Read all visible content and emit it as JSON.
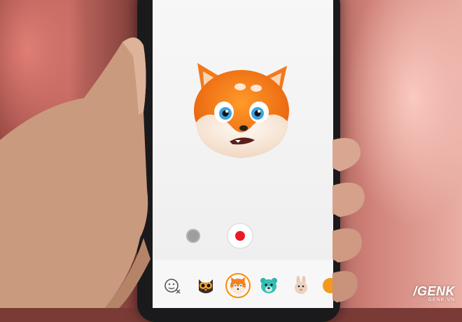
{
  "scene": {
    "description_tags": [
      "hand",
      "phone",
      "animated-emoji-camera"
    ]
  },
  "camera": {
    "selected_avatar": "fox-icon",
    "record_color": "#ea1b27"
  },
  "tray": {
    "items": [
      {
        "name": "emoji-settings-icon"
      },
      {
        "name": "owl-icon"
      },
      {
        "name": "fox-icon",
        "selected": true
      },
      {
        "name": "bear-icon"
      },
      {
        "name": "rabbit-icon"
      },
      {
        "name": "partial-icon"
      }
    ]
  },
  "watermark": {
    "brand": "/GENK",
    "site": "GENK.VN"
  }
}
